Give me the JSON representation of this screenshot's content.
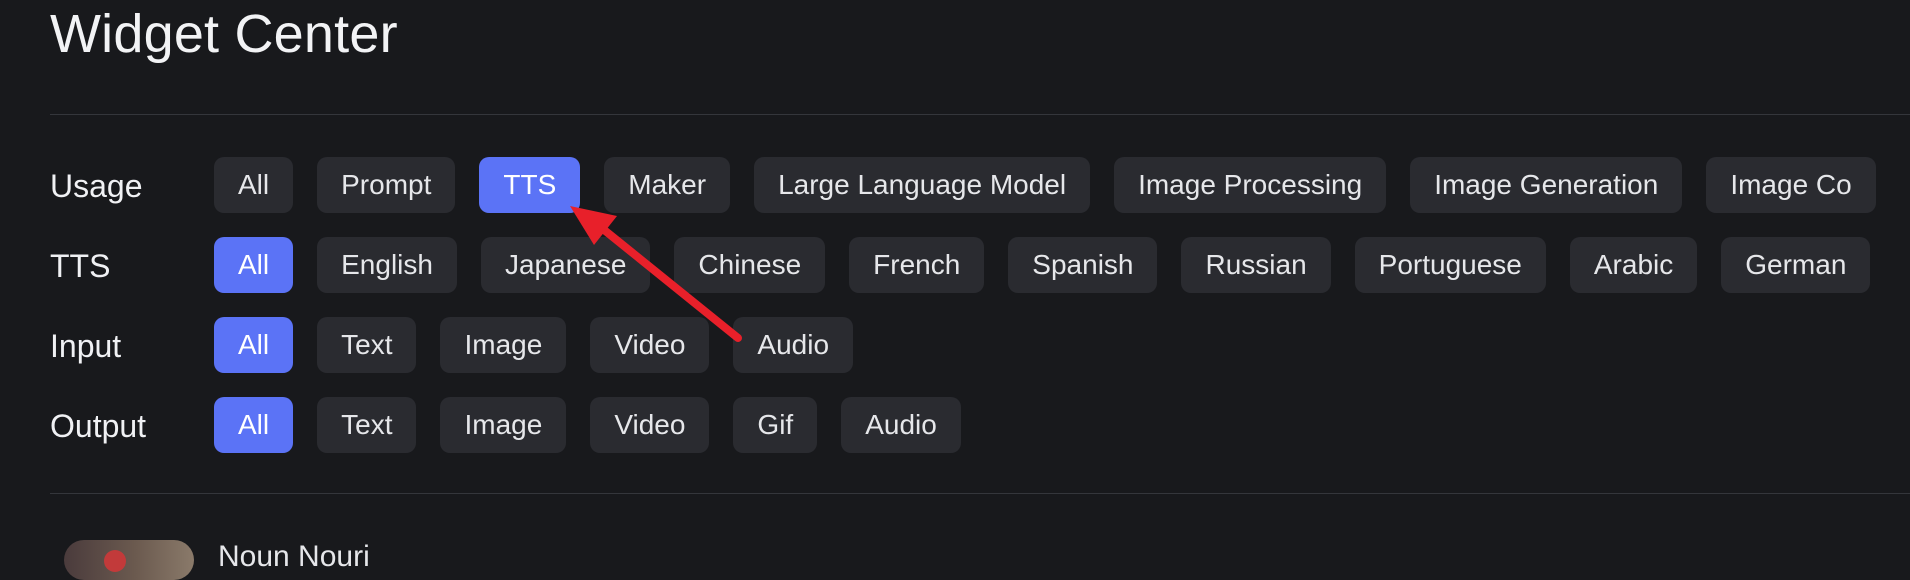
{
  "title": "Widget Center",
  "filters": [
    {
      "label": "Usage",
      "chips": [
        {
          "text": "All",
          "active": false
        },
        {
          "text": "Prompt",
          "active": false
        },
        {
          "text": "TTS",
          "active": true
        },
        {
          "text": "Maker",
          "active": false
        },
        {
          "text": "Large Language Model",
          "active": false
        },
        {
          "text": "Image Processing",
          "active": false
        },
        {
          "text": "Image Generation",
          "active": false
        },
        {
          "text": "Image Co",
          "active": false
        }
      ]
    },
    {
      "label": "TTS",
      "chips": [
        {
          "text": "All",
          "active": true
        },
        {
          "text": "English",
          "active": false
        },
        {
          "text": "Japanese",
          "active": false
        },
        {
          "text": "Chinese",
          "active": false
        },
        {
          "text": "French",
          "active": false
        },
        {
          "text": "Spanish",
          "active": false
        },
        {
          "text": "Russian",
          "active": false
        },
        {
          "text": "Portuguese",
          "active": false
        },
        {
          "text": "Arabic",
          "active": false
        },
        {
          "text": "German",
          "active": false
        }
      ]
    },
    {
      "label": "Input",
      "chips": [
        {
          "text": "All",
          "active": true
        },
        {
          "text": "Text",
          "active": false
        },
        {
          "text": "Image",
          "active": false
        },
        {
          "text": "Video",
          "active": false
        },
        {
          "text": "Audio",
          "active": false
        }
      ]
    },
    {
      "label": "Output",
      "chips": [
        {
          "text": "All",
          "active": true
        },
        {
          "text": "Text",
          "active": false
        },
        {
          "text": "Image",
          "active": false
        },
        {
          "text": "Video",
          "active": false
        },
        {
          "text": "Gif",
          "active": false
        },
        {
          "text": "Audio",
          "active": false
        }
      ]
    }
  ],
  "bottom_item_name": "Noun Nouri",
  "colors": {
    "background": "#18191c",
    "chip": "#2a2b30",
    "chip_active": "#5b73f6",
    "annotation_arrow": "#e8202a"
  }
}
